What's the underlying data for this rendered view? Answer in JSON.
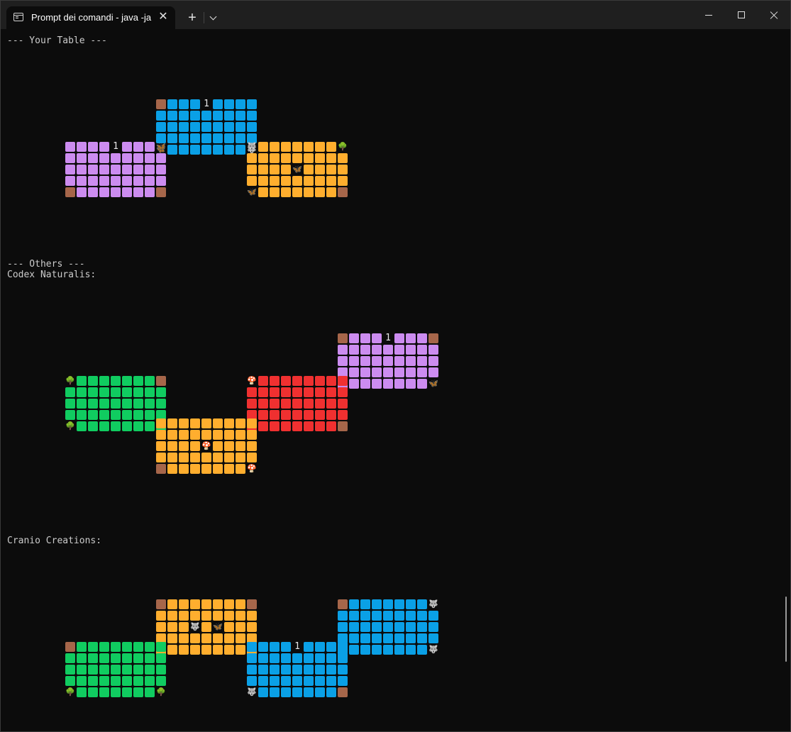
{
  "window": {
    "title": "Prompt dei comandi - java  -ja",
    "icons": {
      "tab": "terminal-icon",
      "close": "close-icon",
      "new_tab": "plus-icon",
      "dropdown": "chevron-down-icon"
    },
    "glyphs": {
      "new_tab": "+",
      "tab_close": "✕"
    }
  },
  "console": {
    "your_table_header": "--- Your Table ---",
    "others_header": "--- Others ---",
    "players": [
      "Codex Naturalis:",
      "Cranio Creations:"
    ]
  },
  "palette": {
    "purple": "#cc8cf0",
    "blue": "#0aa0e6",
    "orange": "#ffae2e",
    "green": "#10cc60",
    "red": "#f03030",
    "brown": "#a6664a",
    "background": "#0c0c0c"
  },
  "symbols": {
    "insect": "🦋",
    "animal": "🐺",
    "plant": "🌳",
    "fungi": "🍄",
    "number_one": "1"
  },
  "boards": [
    {
      "name": "your-table",
      "cards": [
        {
          "color": "blue",
          "col": 1,
          "row": 0,
          "corners": {
            "tl": "brown",
            "tr": "blue",
            "bl": "insect",
            "br": "animal"
          },
          "center": null,
          "top_number": "1"
        },
        {
          "color": "purple",
          "col": 0,
          "row": 1,
          "corners": {
            "tl": "purple",
            "tr": "insect",
            "bl": "brown",
            "br": "brown"
          },
          "center": null,
          "top_number": "1"
        },
        {
          "color": "orange",
          "col": 2,
          "row": 1,
          "corners": {
            "tl": "animal",
            "tr": "plant",
            "bl": "insect",
            "br": "brown"
          },
          "center": "insect",
          "top_number": null
        }
      ]
    },
    {
      "name": "codex-naturalis",
      "cards": [
        {
          "color": "purple",
          "col": 3,
          "row": 0,
          "corners": {
            "tl": "brown",
            "tr": "brown",
            "bl": "purple",
            "br": "insect"
          },
          "center": null,
          "top_number": "1"
        },
        {
          "color": "green",
          "col": 0,
          "row": 1,
          "corners": {
            "tl": "plant",
            "tr": "brown",
            "bl": "plant",
            "br": "green"
          },
          "center": null,
          "top_number": null
        },
        {
          "color": "red",
          "col": 2,
          "row": 1,
          "corners": {
            "tl": "fungi",
            "tr": "red",
            "bl": "red",
            "br": "brown"
          },
          "center": null,
          "top_number": null
        },
        {
          "color": "orange",
          "col": 1,
          "row": 2,
          "corners": {
            "tl": "orange",
            "tr": "orange",
            "bl": "brown",
            "br": "fungi"
          },
          "center": "fungi",
          "top_number": null
        }
      ]
    },
    {
      "name": "cranio-creations",
      "cards": [
        {
          "color": "orange",
          "col": 1,
          "row": 0,
          "corners": {
            "tl": "brown",
            "tr": "brown",
            "bl": "orange",
            "br": "orange"
          },
          "center": "animal+insect",
          "top_number": null
        },
        {
          "color": "blue",
          "col": 3,
          "row": 0,
          "corners": {
            "tl": "brown",
            "tr": "animal",
            "bl": "blue",
            "br": "animal"
          },
          "center": null,
          "top_number": null
        },
        {
          "color": "green",
          "col": 0,
          "row": 1,
          "corners": {
            "tl": "brown",
            "tr": "green",
            "bl": "plant",
            "br": "plant"
          },
          "center": null,
          "top_number": null
        },
        {
          "color": "blue",
          "col": 2,
          "row": 1,
          "corners": {
            "tl": "blue",
            "tr": "blue",
            "bl": "animal",
            "br": "brown"
          },
          "center": null,
          "top_number": "1"
        }
      ]
    }
  ]
}
